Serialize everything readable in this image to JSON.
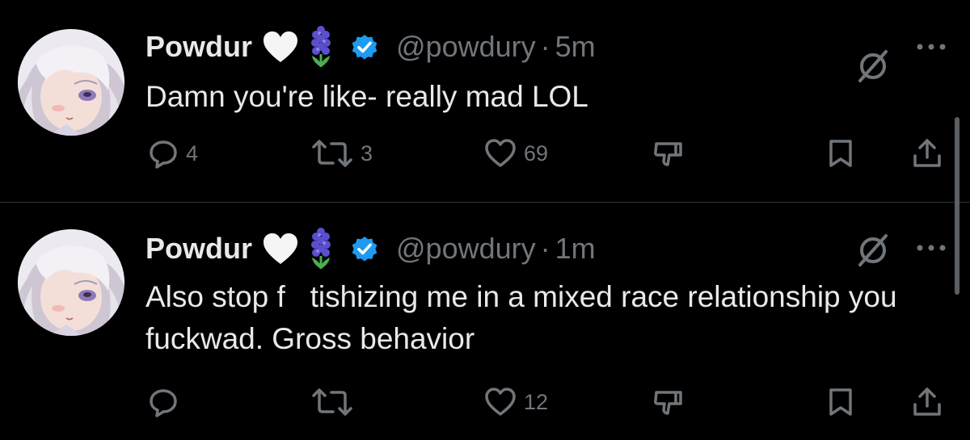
{
  "colors": {
    "background": "#000000",
    "text_primary": "#e7e9ea",
    "text_secondary": "#71767b",
    "verified": "#1d9bf0",
    "divider": "#2f3336"
  },
  "tweets": [
    {
      "display_name": "Powdur",
      "emojis": [
        "white-heart-emoji",
        "hyacinth-emoji"
      ],
      "verified": true,
      "handle": "@powdury",
      "separator": "·",
      "time": "5m",
      "text": "Damn you're like- really mad LOL",
      "actions": {
        "replies": "4",
        "retweets": "3",
        "likes": "69"
      }
    },
    {
      "display_name": "Powdur",
      "emojis": [
        "white-heart-emoji",
        "hyacinth-emoji"
      ],
      "verified": true,
      "handle": "@powdury",
      "separator": "·",
      "time": "1m",
      "text": "Also stop f   tishizing me in a mixed race relationship you fuckwad. Gross behavior",
      "actions": {
        "replies": "",
        "retweets": "",
        "likes": "12"
      }
    }
  ]
}
